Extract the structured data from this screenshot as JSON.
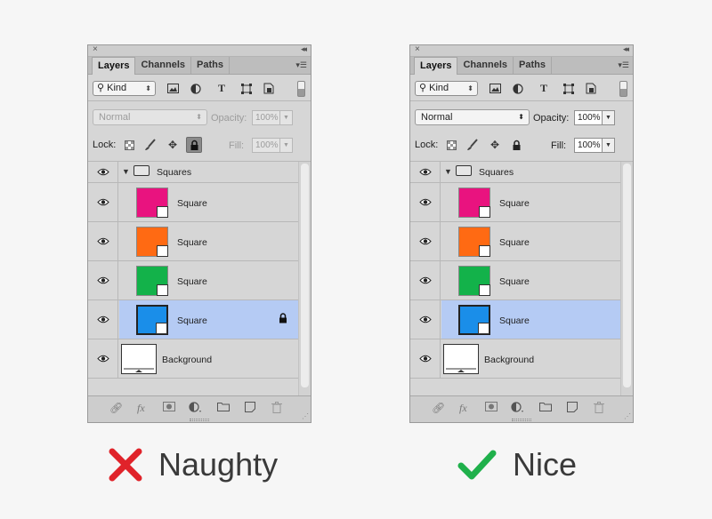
{
  "panels": [
    {
      "id": "naughty",
      "close_glyph": "×",
      "collapse_glyph": "◂◂",
      "tabs": [
        "Layers",
        "Channels",
        "Paths"
      ],
      "active_tab": "Layers",
      "filter": {
        "kind_label": "Kind",
        "icons": [
          "image-filter-icon",
          "adjustment-filter-icon",
          "type-filter-icon",
          "shape-filter-icon",
          "smart-object-filter-icon"
        ]
      },
      "blend_mode": "Normal",
      "opacity_label": "Opacity:",
      "opacity_value": "100%",
      "lock_label": "Lock:",
      "fill_label": "Fill:",
      "fill_value": "100%",
      "controls_disabled": true,
      "lock_all_pressed": true,
      "group": {
        "name": "Squares"
      },
      "layers": [
        {
          "name": "Square",
          "color": "#e9137f",
          "selected": false,
          "locked": false
        },
        {
          "name": "Square",
          "color": "#ff6a13",
          "selected": false,
          "locked": false
        },
        {
          "name": "Square",
          "color": "#13b24a",
          "selected": false,
          "locked": false
        },
        {
          "name": "Square",
          "color": "#1a8ee9",
          "selected": true,
          "locked": true
        }
      ],
      "background": {
        "name": "Background"
      },
      "verdict": {
        "label": "Naughty",
        "mark": "✕",
        "mark_color": "#e0232a"
      }
    },
    {
      "id": "nice",
      "close_glyph": "×",
      "collapse_glyph": "◂◂",
      "tabs": [
        "Layers",
        "Channels",
        "Paths"
      ],
      "active_tab": "Layers",
      "filter": {
        "kind_label": "Kind",
        "icons": [
          "image-filter-icon",
          "adjustment-filter-icon",
          "type-filter-icon",
          "shape-filter-icon",
          "smart-object-filter-icon"
        ]
      },
      "blend_mode": "Normal",
      "opacity_label": "Opacity:",
      "opacity_value": "100%",
      "lock_label": "Lock:",
      "fill_label": "Fill:",
      "fill_value": "100%",
      "controls_disabled": false,
      "lock_all_pressed": false,
      "group": {
        "name": "Squares"
      },
      "layers": [
        {
          "name": "Square",
          "color": "#e9137f",
          "selected": false,
          "locked": false
        },
        {
          "name": "Square",
          "color": "#ff6a13",
          "selected": false,
          "locked": false
        },
        {
          "name": "Square",
          "color": "#13b24a",
          "selected": false,
          "locked": false
        },
        {
          "name": "Square",
          "color": "#1a8ee9",
          "selected": true,
          "locked": false
        }
      ],
      "background": {
        "name": "Background"
      },
      "verdict": {
        "label": "Nice",
        "mark": "✓",
        "mark_color": "#1fb04b"
      }
    }
  ]
}
